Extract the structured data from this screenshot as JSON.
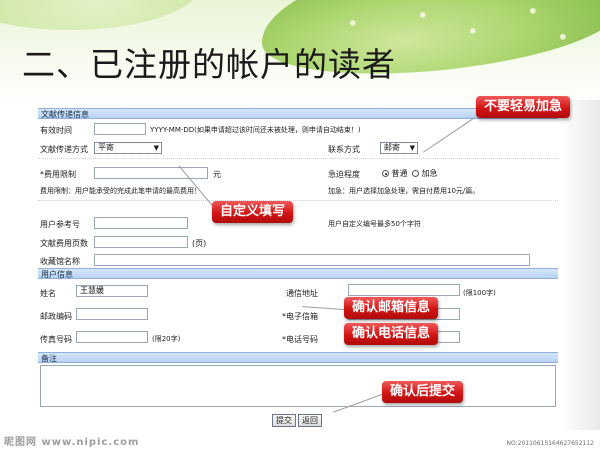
{
  "slide": {
    "title": "二、已注册的帐户的读者"
  },
  "form": {
    "section_delivery": "文献传递信息",
    "valid_time_label": "有效时间",
    "valid_time_value": "",
    "valid_time_hint": "YYYY-MM-DD(如果申请超过该时间还未被处理，则申请自动结束！)",
    "delivery_method_label": "文献传递方式",
    "delivery_method_value": "平寄",
    "contact_method_label": "联系方式",
    "contact_method_value": "邮寄",
    "fee_limit_label": "*费用限制",
    "fee_limit_value": "",
    "fee_unit": "元",
    "urgency_label": "急迫程度",
    "urgency_normal": "普通",
    "urgency_urgent": "加急",
    "fee_limit_note": "费用限制：用户能承受的完成此笔申请的最高费用！",
    "urgent_note": "加急：用户选择加急处理，需自付费用10元/篇。",
    "user_ref_label": "用户参考号",
    "user_ref_value": "",
    "user_ref_note": "用户自定义编号最多50个字符",
    "pages_label": "文献费用页数",
    "pages_value": "",
    "pages_unit": "(页)",
    "collection_label": "收藏馆名称",
    "collection_value": "",
    "section_user": "用户信息",
    "name_label": "姓名",
    "name_value": "王慧媛",
    "address_label": "通信地址",
    "address_value": "",
    "address_limit": "(限100字)",
    "zip_label": "邮政编码",
    "zip_value": "",
    "email_label": "*电子信箱",
    "email_value": "",
    "fax_label": "传真号码",
    "fax_value": "",
    "fax_limit": "(限20字)",
    "phone_label": "*电话号码",
    "phone_value": "",
    "section_note": "备注",
    "note_value": "",
    "submit_label": "提交",
    "back_label": "返回"
  },
  "callouts": {
    "no_urgent": "不要轻易加急",
    "custom_fill": "自定义填写",
    "confirm_address": "确认邮箱信息",
    "confirm_phone": "确认电话信息",
    "confirm_submit": "确认后提交"
  },
  "watermark": {
    "left": "昵图网 www.nipic.com",
    "right": "NO:20110615164627652112"
  },
  "colors": {
    "section_header": "#c6dbf6",
    "callout_red": "#d21414"
  }
}
